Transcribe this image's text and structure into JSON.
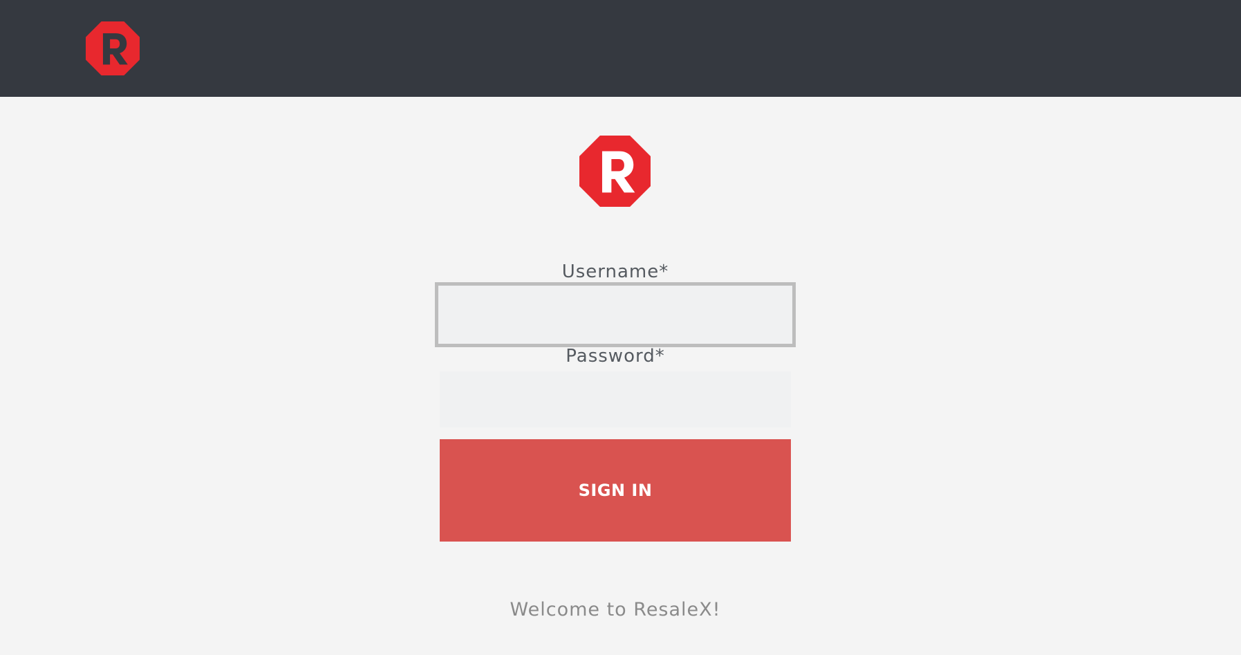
{
  "header": {
    "logo_icon": "resalex-logo-icon"
  },
  "brand": {
    "logo_letter": "R",
    "logo_color": "#e8282e",
    "logo_icon": "resalex-logo-icon"
  },
  "colors": {
    "topbar": "#353940",
    "background": "#f4f4f4",
    "button": "#d95350",
    "field": "#f0f1f2",
    "focus_border": "#bdbdbd"
  },
  "form": {
    "username_label": "Username*",
    "username_value": "",
    "username_placeholder": "",
    "password_label": "Password*",
    "password_value": "",
    "password_placeholder": "",
    "signin_label": "SIGN IN"
  },
  "footer": {
    "welcome_text": "Welcome to ResaleX!"
  }
}
